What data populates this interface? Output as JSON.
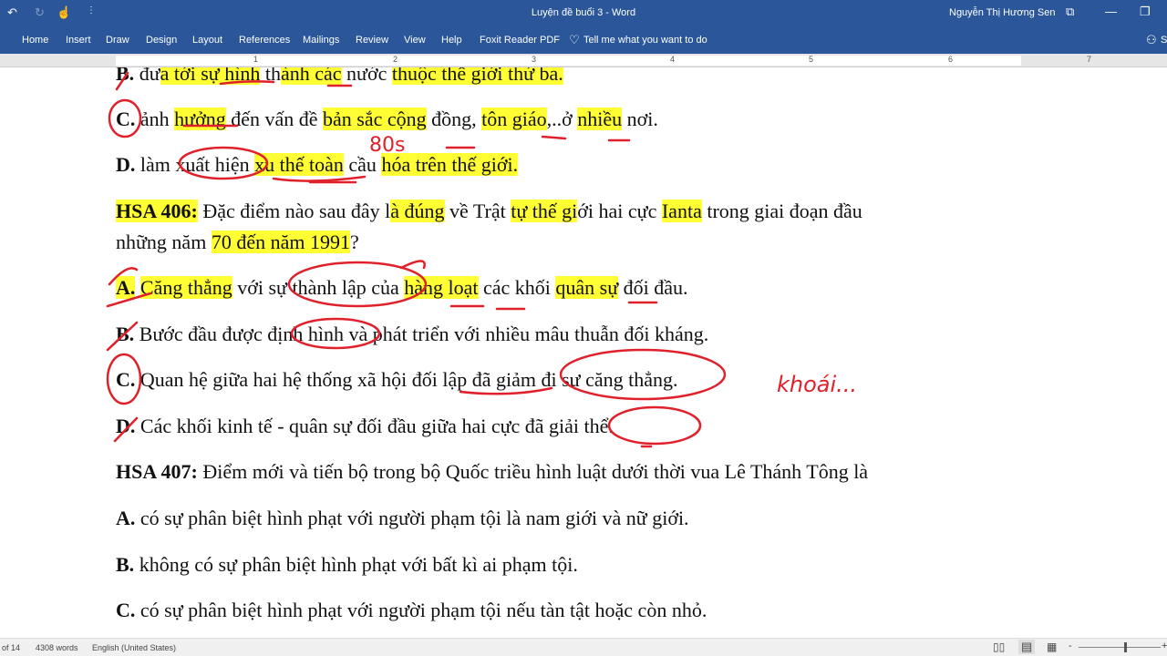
{
  "titlebar": {
    "title": "Luyện đề buổi 3  -  Word",
    "user": "Nguyễn Thị Hương Sen",
    "undo": "↶",
    "redo": "↻",
    "touch": "☝",
    "customize": "⋮"
  },
  "tabs": [
    "Home",
    "Insert",
    "Draw",
    "Design",
    "Layout",
    "References",
    "Mailings",
    "Review",
    "View",
    "Help",
    "Foxit Reader PDF"
  ],
  "tell_me": "Tell me what you want to do",
  "share": "S",
  "ruler": [
    "1",
    "2",
    "3",
    "4",
    "5",
    "6",
    "7"
  ],
  "document": {
    "lines": [
      [
        {
          "t": "B.",
          "b": 1
        },
        {
          "t": " đư"
        },
        {
          "t": "a tới sự hình",
          "h": 1
        },
        {
          "t": " th"
        },
        {
          "t": "ành các",
          "h": 1
        },
        {
          "t": " nước "
        },
        {
          "t": "thuộc thế giới thứ ba.",
          "h": 1
        }
      ],
      [
        {
          "t": "C.",
          "b": 1
        },
        {
          "t": " ảnh "
        },
        {
          "t": "hưởng",
          "h": 1
        },
        {
          "t": " đến vấn đề "
        },
        {
          "t": "bản sắc cộng",
          "h": 1
        },
        {
          "t": " đồng, "
        },
        {
          "t": "tôn giáo",
          "h": 1
        },
        {
          "t": ",..ở "
        },
        {
          "t": "nhiều",
          "h": 1
        },
        {
          "t": " nơi."
        }
      ],
      [
        {
          "t": "D.",
          "b": 1
        },
        {
          "t": " làm xuất hiện "
        },
        {
          "t": "xu thế toàn",
          "h": 1
        },
        {
          "t": " cầu "
        },
        {
          "t": "hóa trên thế giới.      ",
          "h": 1
        }
      ],
      [
        {
          "t": "HSA 406:",
          "b": 1,
          "h": 1
        },
        {
          "t": " Đặc điểm nào sau đây l"
        },
        {
          "t": "à đúng",
          "h": 1
        },
        {
          "t": " về Trật "
        },
        {
          "t": "tự thế gi",
          "h": 1
        },
        {
          "t": "ới hai cực "
        },
        {
          "t": "Ianta",
          "h": 1
        },
        {
          "t": " trong giai đoạn đầu"
        }
      ],
      [
        {
          "t": "những năm "
        },
        {
          "t": "70 đến năm 1991",
          "h": 1
        },
        {
          "t": "?"
        }
      ],
      [
        {
          "t": "A.",
          "b": 1,
          "h": 1
        },
        {
          "t": " "
        },
        {
          "t": "Căng thẳng",
          "h": 1
        },
        {
          "t": " với sự thành lập của "
        },
        {
          "t": "hàng loạt",
          "h": 1
        },
        {
          "t": " các khối "
        },
        {
          "t": "quân sự",
          "h": 1
        },
        {
          "t": " đối đầu."
        }
      ],
      [
        {
          "t": "B.",
          "b": 1
        },
        {
          "t": " Bước đầu được định hình và phát triển với nhiều mâu thuẫn đối kháng."
        }
      ],
      [
        {
          "t": "C.",
          "b": 1
        },
        {
          "t": " Quan hệ giữa hai hệ thống xã hội đối lập đã giảm đi sự căng thẳng."
        }
      ],
      [
        {
          "t": "D.",
          "b": 1
        },
        {
          "t": " Các khối kinh tế - quân sự đối đầu giữa hai cực đã giải thể."
        }
      ],
      [
        {
          "t": "HSA 407:",
          "b": 1
        },
        {
          "t": " Điểm mới và tiến bộ trong bộ Quốc triều hình luật dưới thời vua Lê Thánh Tông là"
        }
      ],
      [
        {
          "t": "A.",
          "b": 1
        },
        {
          "t": " có sự phân biệt hình phạt với người phạm tội là nam giới và nữ giới."
        }
      ],
      [
        {
          "t": "B.",
          "b": 1
        },
        {
          "t": " không có sự phân biệt hình phạt với bất kì ai phạm tội."
        }
      ],
      [
        {
          "t": "C.",
          "b": 1
        },
        {
          "t": " có sự phân biệt hình phạt với người phạm tội nếu tàn tật hoặc còn nhỏ."
        }
      ]
    ],
    "annotations": [
      "80s",
      "khoái..."
    ]
  },
  "status": {
    "page": "of 14",
    "words": "4308 words",
    "language": "English (United States)"
  },
  "colors": {
    "ribbon": "#2b579a",
    "highlight": "#ffff33",
    "ink": "#e0202a"
  }
}
